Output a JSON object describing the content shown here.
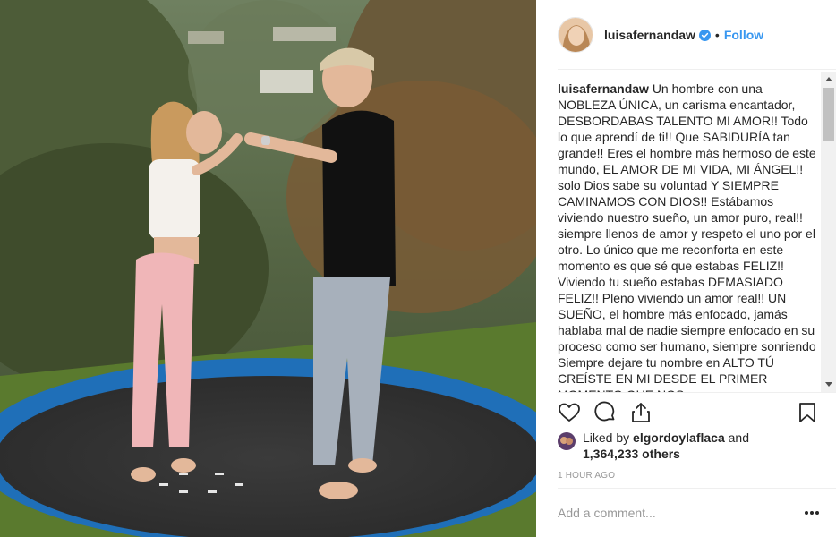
{
  "post": {
    "author": {
      "username": "luisafernandaw",
      "verified_icon": "verified-badge-icon",
      "follow_label": "Follow",
      "separator": "•"
    },
    "caption": {
      "username": "luisafernandaw",
      "text": "Un hombre con una NOBLEZA ÚNICA, un carisma encantador, DESBORDABAS TALENTO MI AMOR!! Todo lo que aprendí de ti!! Que SABIDURÍA tan grande!! Eres el hombre más hermoso de este mundo, EL AMOR DE MI VIDA, MI ÁNGEL!! solo Dios sabe su voluntad Y SIEMPRE CAMINAMOS CON DIOS!! Estábamos viviendo nuestro sueño, un amor puro, real!! siempre llenos de amor y respeto el uno por el otro. Lo único que me reconforta en este momento es que sé que estabas FELIZ!! Viviendo tu sueño estabas DEMASIADO FELIZ!! Pleno viviendo un amor real!! UN SUEÑO, el hombre más enfocado, jamás hablaba mal de nadie siempre enfocado en su proceso como ser humano, siempre sonriendo Siempre dejare tu nombre en ALTO TÚ CREÍSTE EN MI DESDE EL PRIMER MOMENTO QUE NOS"
    },
    "actions": {
      "like_icon": "heart-icon",
      "comment_icon": "comment-bubble-icon",
      "share_icon": "share-icon",
      "save_icon": "bookmark-icon"
    },
    "likes": {
      "prefix": "Liked by",
      "user": "elgordoylaflaca",
      "conjunction": "and",
      "count": "1,364,233 others"
    },
    "time_ago": "1 HOUR AGO",
    "comment": {
      "placeholder": "Add a comment...",
      "more_icon": "more-options-icon"
    }
  },
  "colors": {
    "link_blue": "#3897f0",
    "text": "#262626",
    "muted": "#999999",
    "divider": "#efefef"
  }
}
